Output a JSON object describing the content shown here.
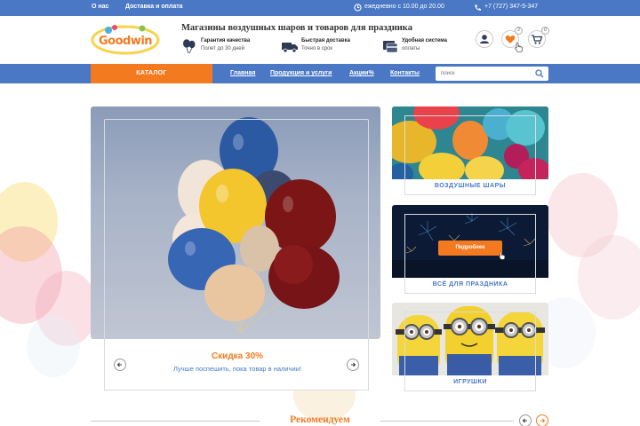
{
  "topbar": {
    "about": "О нас",
    "delivery": "Доставка и оплата",
    "hours": "ежедневно с 10.00 до 20.00",
    "phone": "+7 (727) 347-5-347"
  },
  "header": {
    "logo_text": "Goodwin",
    "tagline": "Магазины воздушных шаров и товаров для праздника",
    "features": [
      {
        "icon": "balloon-icon",
        "line1": "Гарантия качества",
        "line2": "Полет до 30 дней"
      },
      {
        "icon": "truck-icon",
        "line1": "Быстрая доставка",
        "line2": "Точно в срок"
      },
      {
        "icon": "payment-icon",
        "line1": "Удобная система",
        "line2": "оплаты"
      }
    ],
    "wishlist_count": "2",
    "cart_count": "0"
  },
  "nav": {
    "catalog": "КАТАЛОГ",
    "links": [
      "Главная",
      "Продукция и услуги",
      "Акции%",
      "Контакты"
    ],
    "search_placeholder": "поиск"
  },
  "slider": {
    "title": "Скидка 30%",
    "subtitle": "Лучше поспешить, пока товар в наличии!"
  },
  "categories": [
    {
      "label": "ВОЗДУШНЫЕ ШАРЫ"
    },
    {
      "label": "ВСЁ ДЛЯ ПРАЗДНИКА",
      "button": "Подробнее"
    },
    {
      "label": "ИГРУШКИ"
    }
  ],
  "recommend": {
    "title": "Рекомендуем"
  },
  "colors": {
    "primary": "#4a78c5",
    "accent": "#f47a20"
  }
}
